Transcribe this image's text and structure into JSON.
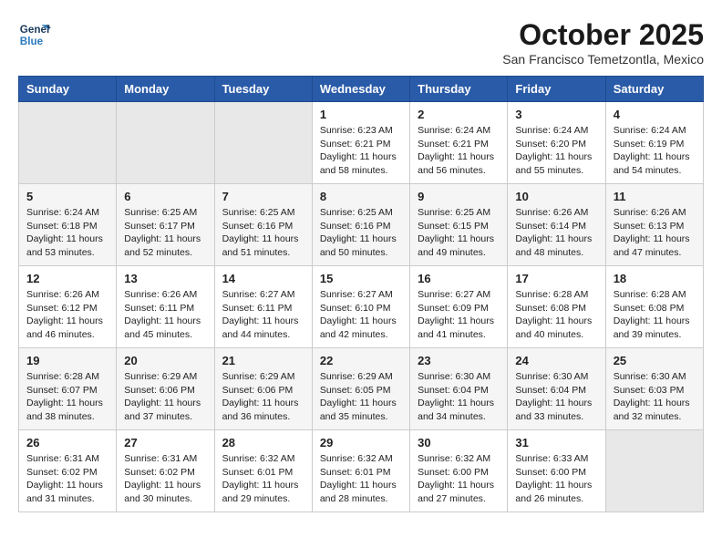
{
  "logo": {
    "line1": "General",
    "line2": "Blue"
  },
  "title": "October 2025",
  "subtitle": "San Francisco Temetzontla, Mexico",
  "days_of_week": [
    "Sunday",
    "Monday",
    "Tuesday",
    "Wednesday",
    "Thursday",
    "Friday",
    "Saturday"
  ],
  "weeks": [
    [
      {
        "day": "",
        "info": ""
      },
      {
        "day": "",
        "info": ""
      },
      {
        "day": "",
        "info": ""
      },
      {
        "day": "1",
        "info": "Sunrise: 6:23 AM\nSunset: 6:21 PM\nDaylight: 11 hours\nand 58 minutes."
      },
      {
        "day": "2",
        "info": "Sunrise: 6:24 AM\nSunset: 6:21 PM\nDaylight: 11 hours\nand 56 minutes."
      },
      {
        "day": "3",
        "info": "Sunrise: 6:24 AM\nSunset: 6:20 PM\nDaylight: 11 hours\nand 55 minutes."
      },
      {
        "day": "4",
        "info": "Sunrise: 6:24 AM\nSunset: 6:19 PM\nDaylight: 11 hours\nand 54 minutes."
      }
    ],
    [
      {
        "day": "5",
        "info": "Sunrise: 6:24 AM\nSunset: 6:18 PM\nDaylight: 11 hours\nand 53 minutes."
      },
      {
        "day": "6",
        "info": "Sunrise: 6:25 AM\nSunset: 6:17 PM\nDaylight: 11 hours\nand 52 minutes."
      },
      {
        "day": "7",
        "info": "Sunrise: 6:25 AM\nSunset: 6:16 PM\nDaylight: 11 hours\nand 51 minutes."
      },
      {
        "day": "8",
        "info": "Sunrise: 6:25 AM\nSunset: 6:16 PM\nDaylight: 11 hours\nand 50 minutes."
      },
      {
        "day": "9",
        "info": "Sunrise: 6:25 AM\nSunset: 6:15 PM\nDaylight: 11 hours\nand 49 minutes."
      },
      {
        "day": "10",
        "info": "Sunrise: 6:26 AM\nSunset: 6:14 PM\nDaylight: 11 hours\nand 48 minutes."
      },
      {
        "day": "11",
        "info": "Sunrise: 6:26 AM\nSunset: 6:13 PM\nDaylight: 11 hours\nand 47 minutes."
      }
    ],
    [
      {
        "day": "12",
        "info": "Sunrise: 6:26 AM\nSunset: 6:12 PM\nDaylight: 11 hours\nand 46 minutes."
      },
      {
        "day": "13",
        "info": "Sunrise: 6:26 AM\nSunset: 6:11 PM\nDaylight: 11 hours\nand 45 minutes."
      },
      {
        "day": "14",
        "info": "Sunrise: 6:27 AM\nSunset: 6:11 PM\nDaylight: 11 hours\nand 44 minutes."
      },
      {
        "day": "15",
        "info": "Sunrise: 6:27 AM\nSunset: 6:10 PM\nDaylight: 11 hours\nand 42 minutes."
      },
      {
        "day": "16",
        "info": "Sunrise: 6:27 AM\nSunset: 6:09 PM\nDaylight: 11 hours\nand 41 minutes."
      },
      {
        "day": "17",
        "info": "Sunrise: 6:28 AM\nSunset: 6:08 PM\nDaylight: 11 hours\nand 40 minutes."
      },
      {
        "day": "18",
        "info": "Sunrise: 6:28 AM\nSunset: 6:08 PM\nDaylight: 11 hours\nand 39 minutes."
      }
    ],
    [
      {
        "day": "19",
        "info": "Sunrise: 6:28 AM\nSunset: 6:07 PM\nDaylight: 11 hours\nand 38 minutes."
      },
      {
        "day": "20",
        "info": "Sunrise: 6:29 AM\nSunset: 6:06 PM\nDaylight: 11 hours\nand 37 minutes."
      },
      {
        "day": "21",
        "info": "Sunrise: 6:29 AM\nSunset: 6:06 PM\nDaylight: 11 hours\nand 36 minutes."
      },
      {
        "day": "22",
        "info": "Sunrise: 6:29 AM\nSunset: 6:05 PM\nDaylight: 11 hours\nand 35 minutes."
      },
      {
        "day": "23",
        "info": "Sunrise: 6:30 AM\nSunset: 6:04 PM\nDaylight: 11 hours\nand 34 minutes."
      },
      {
        "day": "24",
        "info": "Sunrise: 6:30 AM\nSunset: 6:04 PM\nDaylight: 11 hours\nand 33 minutes."
      },
      {
        "day": "25",
        "info": "Sunrise: 6:30 AM\nSunset: 6:03 PM\nDaylight: 11 hours\nand 32 minutes."
      }
    ],
    [
      {
        "day": "26",
        "info": "Sunrise: 6:31 AM\nSunset: 6:02 PM\nDaylight: 11 hours\nand 31 minutes."
      },
      {
        "day": "27",
        "info": "Sunrise: 6:31 AM\nSunset: 6:02 PM\nDaylight: 11 hours\nand 30 minutes."
      },
      {
        "day": "28",
        "info": "Sunrise: 6:32 AM\nSunset: 6:01 PM\nDaylight: 11 hours\nand 29 minutes."
      },
      {
        "day": "29",
        "info": "Sunrise: 6:32 AM\nSunset: 6:01 PM\nDaylight: 11 hours\nand 28 minutes."
      },
      {
        "day": "30",
        "info": "Sunrise: 6:32 AM\nSunset: 6:00 PM\nDaylight: 11 hours\nand 27 minutes."
      },
      {
        "day": "31",
        "info": "Sunrise: 6:33 AM\nSunset: 6:00 PM\nDaylight: 11 hours\nand 26 minutes."
      },
      {
        "day": "",
        "info": ""
      }
    ]
  ]
}
